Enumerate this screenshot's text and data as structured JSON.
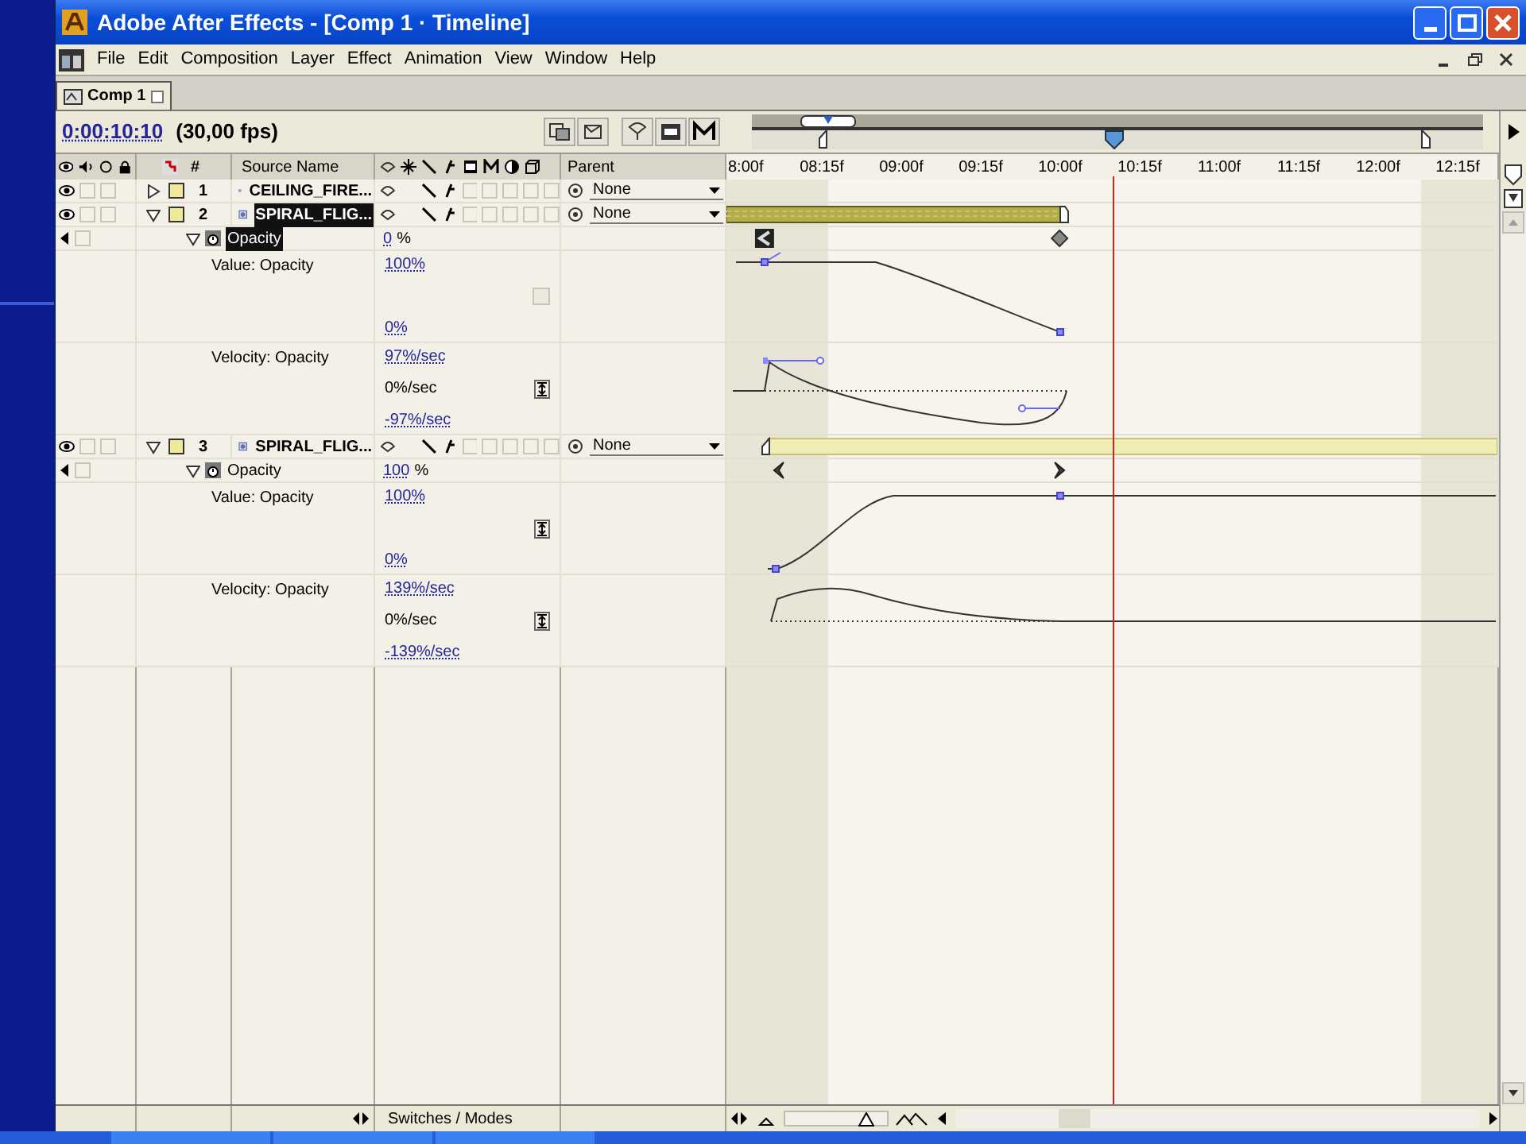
{
  "window": {
    "title": "Adobe After Effects - [Comp 1 · Timeline]"
  },
  "menu": [
    "File",
    "Edit",
    "Composition",
    "Layer",
    "Effect",
    "Animation",
    "View",
    "Window",
    "Help"
  ],
  "tabs": [
    {
      "label": "Comp 1",
      "selected": true
    }
  ],
  "timecode": "0:00:10:10",
  "frame_rate": "(30,00 fps)",
  "time_slider": {
    "level": 0.495
  },
  "columns": {
    "number": "#",
    "source_name": "Source Name",
    "parent": "Parent"
  },
  "ruler": [
    "8:00f",
    "08:15f",
    "09:00f",
    "09:15f",
    "10:00f",
    "10:15f",
    "11:00f",
    "11:15f",
    "12:00f",
    "12:15f"
  ],
  "layers": [
    {
      "number": "1",
      "name": "CEILING_FIRE...",
      "selected": false,
      "expanded": false,
      "parent": "None"
    },
    {
      "number": "2",
      "name": "SPIRAL_FLIG...",
      "selected": true,
      "expanded": true,
      "parent": "None",
      "bar": {
        "kind": "textured"
      },
      "properties": [
        {
          "name": "Opacity",
          "value": "0",
          "unit": "%",
          "selected": true,
          "expanded": true,
          "keyframe_checked": false,
          "graphs": [
            {
              "kind": "value",
              "label": "Value: Opacity",
              "max": "100%",
              "min": "0%",
              "button": {
                "kind": "empty"
              }
            },
            {
              "kind": "velocity",
              "label": "Velocity: Opacity",
              "max": "97%/sec",
              "zero": "0%/sec",
              "min": "-97%/sec",
              "button": {
                "kind": "fit"
              }
            }
          ]
        }
      ]
    },
    {
      "number": "3",
      "name": "SPIRAL_FLIG...",
      "selected": false,
      "expanded": true,
      "parent": "None",
      "bar": {
        "kind": "plain"
      },
      "properties": [
        {
          "name": "Opacity",
          "value": "100",
          "unit": "%",
          "selected": false,
          "expanded": true,
          "keyframe_checked": false,
          "graphs": [
            {
              "kind": "value",
              "label": "Value: Opacity",
              "max": "100%",
              "min": "0%",
              "button": {
                "kind": "fit"
              }
            },
            {
              "kind": "velocity",
              "label": "Velocity: Opacity",
              "max": "139%/sec",
              "zero": "0%/sec",
              "min": "-139%/sec",
              "button": {
                "kind": "fit"
              }
            }
          ]
        }
      ]
    }
  ],
  "footer": {
    "toggle_label": "Switches / Modes",
    "zoom": {
      "level": 0.85
    }
  }
}
